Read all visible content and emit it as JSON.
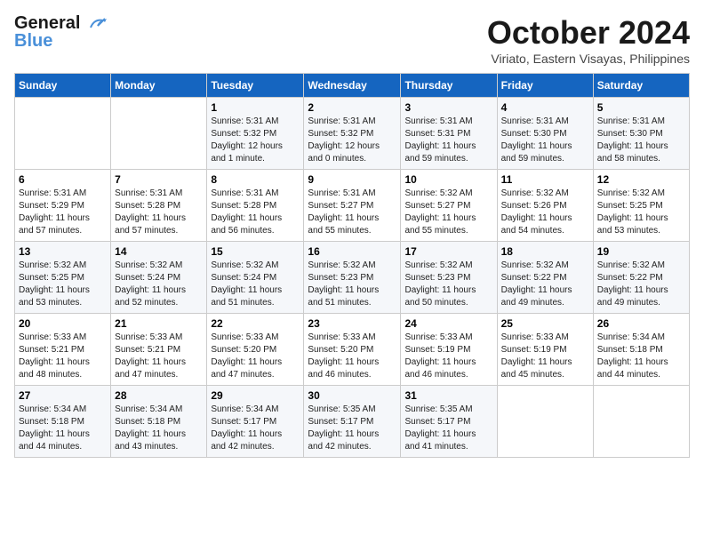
{
  "header": {
    "logo_line1": "General",
    "logo_line2": "Blue",
    "month_title": "October 2024",
    "subtitle": "Viriato, Eastern Visayas, Philippines"
  },
  "weekdays": [
    "Sunday",
    "Monday",
    "Tuesday",
    "Wednesday",
    "Thursday",
    "Friday",
    "Saturday"
  ],
  "weeks": [
    [
      {
        "day": "",
        "detail": ""
      },
      {
        "day": "",
        "detail": ""
      },
      {
        "day": "1",
        "detail": "Sunrise: 5:31 AM\nSunset: 5:32 PM\nDaylight: 12 hours\nand 1 minute."
      },
      {
        "day": "2",
        "detail": "Sunrise: 5:31 AM\nSunset: 5:32 PM\nDaylight: 12 hours\nand 0 minutes."
      },
      {
        "day": "3",
        "detail": "Sunrise: 5:31 AM\nSunset: 5:31 PM\nDaylight: 11 hours\nand 59 minutes."
      },
      {
        "day": "4",
        "detail": "Sunrise: 5:31 AM\nSunset: 5:30 PM\nDaylight: 11 hours\nand 59 minutes."
      },
      {
        "day": "5",
        "detail": "Sunrise: 5:31 AM\nSunset: 5:30 PM\nDaylight: 11 hours\nand 58 minutes."
      }
    ],
    [
      {
        "day": "6",
        "detail": "Sunrise: 5:31 AM\nSunset: 5:29 PM\nDaylight: 11 hours\nand 57 minutes."
      },
      {
        "day": "7",
        "detail": "Sunrise: 5:31 AM\nSunset: 5:28 PM\nDaylight: 11 hours\nand 57 minutes."
      },
      {
        "day": "8",
        "detail": "Sunrise: 5:31 AM\nSunset: 5:28 PM\nDaylight: 11 hours\nand 56 minutes."
      },
      {
        "day": "9",
        "detail": "Sunrise: 5:31 AM\nSunset: 5:27 PM\nDaylight: 11 hours\nand 55 minutes."
      },
      {
        "day": "10",
        "detail": "Sunrise: 5:32 AM\nSunset: 5:27 PM\nDaylight: 11 hours\nand 55 minutes."
      },
      {
        "day": "11",
        "detail": "Sunrise: 5:32 AM\nSunset: 5:26 PM\nDaylight: 11 hours\nand 54 minutes."
      },
      {
        "day": "12",
        "detail": "Sunrise: 5:32 AM\nSunset: 5:25 PM\nDaylight: 11 hours\nand 53 minutes."
      }
    ],
    [
      {
        "day": "13",
        "detail": "Sunrise: 5:32 AM\nSunset: 5:25 PM\nDaylight: 11 hours\nand 53 minutes."
      },
      {
        "day": "14",
        "detail": "Sunrise: 5:32 AM\nSunset: 5:24 PM\nDaylight: 11 hours\nand 52 minutes."
      },
      {
        "day": "15",
        "detail": "Sunrise: 5:32 AM\nSunset: 5:24 PM\nDaylight: 11 hours\nand 51 minutes."
      },
      {
        "day": "16",
        "detail": "Sunrise: 5:32 AM\nSunset: 5:23 PM\nDaylight: 11 hours\nand 51 minutes."
      },
      {
        "day": "17",
        "detail": "Sunrise: 5:32 AM\nSunset: 5:23 PM\nDaylight: 11 hours\nand 50 minutes."
      },
      {
        "day": "18",
        "detail": "Sunrise: 5:32 AM\nSunset: 5:22 PM\nDaylight: 11 hours\nand 49 minutes."
      },
      {
        "day": "19",
        "detail": "Sunrise: 5:32 AM\nSunset: 5:22 PM\nDaylight: 11 hours\nand 49 minutes."
      }
    ],
    [
      {
        "day": "20",
        "detail": "Sunrise: 5:33 AM\nSunset: 5:21 PM\nDaylight: 11 hours\nand 48 minutes."
      },
      {
        "day": "21",
        "detail": "Sunrise: 5:33 AM\nSunset: 5:21 PM\nDaylight: 11 hours\nand 47 minutes."
      },
      {
        "day": "22",
        "detail": "Sunrise: 5:33 AM\nSunset: 5:20 PM\nDaylight: 11 hours\nand 47 minutes."
      },
      {
        "day": "23",
        "detail": "Sunrise: 5:33 AM\nSunset: 5:20 PM\nDaylight: 11 hours\nand 46 minutes."
      },
      {
        "day": "24",
        "detail": "Sunrise: 5:33 AM\nSunset: 5:19 PM\nDaylight: 11 hours\nand 46 minutes."
      },
      {
        "day": "25",
        "detail": "Sunrise: 5:33 AM\nSunset: 5:19 PM\nDaylight: 11 hours\nand 45 minutes."
      },
      {
        "day": "26",
        "detail": "Sunrise: 5:34 AM\nSunset: 5:18 PM\nDaylight: 11 hours\nand 44 minutes."
      }
    ],
    [
      {
        "day": "27",
        "detail": "Sunrise: 5:34 AM\nSunset: 5:18 PM\nDaylight: 11 hours\nand 44 minutes."
      },
      {
        "day": "28",
        "detail": "Sunrise: 5:34 AM\nSunset: 5:18 PM\nDaylight: 11 hours\nand 43 minutes."
      },
      {
        "day": "29",
        "detail": "Sunrise: 5:34 AM\nSunset: 5:17 PM\nDaylight: 11 hours\nand 42 minutes."
      },
      {
        "day": "30",
        "detail": "Sunrise: 5:35 AM\nSunset: 5:17 PM\nDaylight: 11 hours\nand 42 minutes."
      },
      {
        "day": "31",
        "detail": "Sunrise: 5:35 AM\nSunset: 5:17 PM\nDaylight: 11 hours\nand 41 minutes."
      },
      {
        "day": "",
        "detail": ""
      },
      {
        "day": "",
        "detail": ""
      }
    ]
  ]
}
